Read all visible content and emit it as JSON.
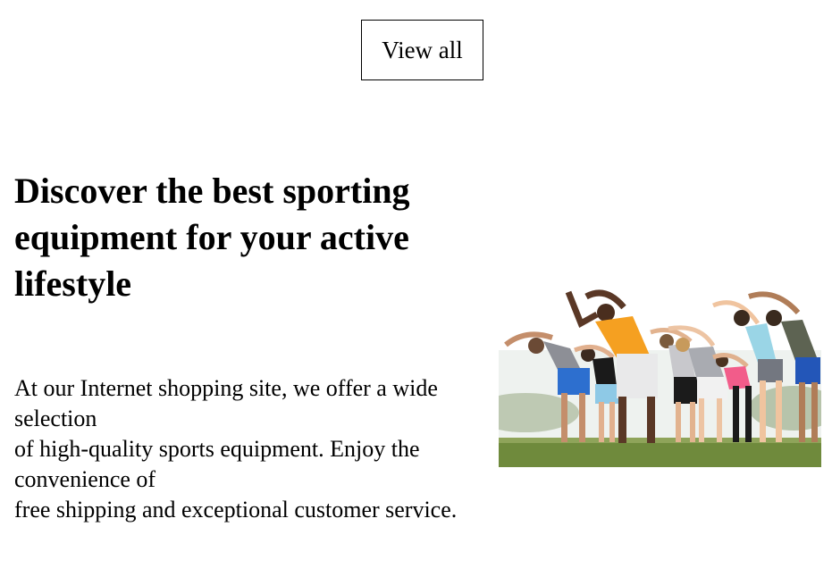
{
  "actions": {
    "view_all_label": "View all"
  },
  "hero": {
    "title": "Discover the best sporting equipment for your active lifestyle",
    "paragraph_lines": [
      "At our Internet shopping site, we offer a wide selection",
      "of high-quality sports equipment. Enjoy the convenience of",
      "free shipping and exceptional customer service."
    ]
  },
  "colors": {
    "border": "#000000",
    "grass": "#6f8a3c",
    "sky": "#eef2ef"
  }
}
